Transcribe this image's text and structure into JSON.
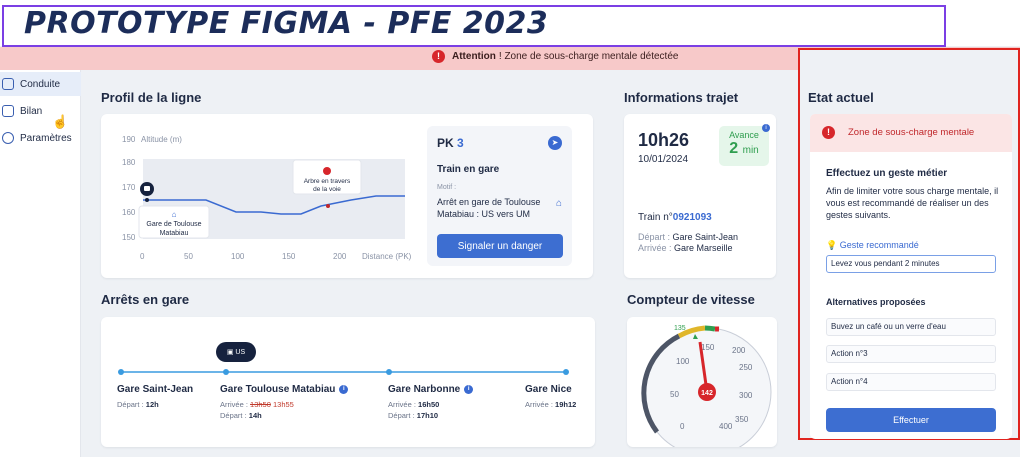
{
  "title": "PROTOTYPE FIGMA - PFE 2023",
  "alert": {
    "bold": "Attention",
    "text": "! Zone de sous-charge mentale détectée",
    "icon": "alert-icon",
    "bg": "#f7c9c9"
  },
  "sidebar": {
    "items": [
      {
        "label": "Conduite",
        "icon": "train-icon"
      },
      {
        "label": "Bilan",
        "icon": "chart-icon"
      },
      {
        "label": "Paramètres",
        "icon": "gear-icon"
      }
    ]
  },
  "profil": {
    "title": "Profil de la ligne",
    "yaxis_label": "Altitude (m)",
    "xaxis_label": "Distance (PK)",
    "y_ticks": [
      "190",
      "180",
      "170",
      "160",
      "150"
    ],
    "x_ticks": [
      "0",
      "50",
      "100",
      "150",
      "200"
    ],
    "station_label": "Gare de Toulouse Matabiau",
    "obstacle_label": "Arbre en travers de la voie",
    "pk": {
      "label": "PK",
      "value": "3"
    },
    "status": "Train en gare",
    "motif_label": "Motif :",
    "motif": "Arrêt en gare de Toulouse Matabiau : US vers UM",
    "danger_button": "Signaler un danger"
  },
  "trajet": {
    "title": "Informations trajet",
    "time": "10h26",
    "date": "10/01/2024",
    "avance_label": "Avance",
    "avance_value": "2",
    "avance_unit": "min",
    "train_label": "Train n°",
    "train_number": "0921093",
    "depart_label": "Départ :",
    "depart": "Gare Saint-Jean",
    "arrivee_label": "Arrivée :",
    "arrivee": "Gare Marseille"
  },
  "arrets": {
    "title": "Arrêts en gare",
    "train_badge": "US",
    "stops": [
      {
        "name": "Gare Saint-Jean",
        "line1_label": "Départ :",
        "line1_value": "12h"
      },
      {
        "name": "Gare Toulouse Matabiau",
        "line1_label": "Arrivée :",
        "line1_old": "13h50",
        "line1_new": "13h55",
        "line2_label": "Départ :",
        "line2_value": "14h"
      },
      {
        "name": "Gare Narbonne",
        "line1_label": "Arrivée :",
        "line1_value": "16h50",
        "line2_label": "Départ :",
        "line2_value": "17h10"
      },
      {
        "name": "Gare Nice",
        "line1_label": "Arrivée :",
        "line1_value": "19h12"
      }
    ]
  },
  "vitesse": {
    "title": "Compteur de vitesse",
    "current": "142",
    "limit": "135",
    "ticks": [
      "0",
      "50",
      "100",
      "150",
      "200",
      "250",
      "300",
      "350",
      "400"
    ]
  },
  "etat": {
    "title": "Etat actuel",
    "alert": "Zone de sous-charge mentale",
    "question": "Effectuez un geste métier",
    "paragraph": "Afin de limiter votre sous charge mentale, il vous est recommandé de réaliser un des gestes suivants.",
    "recommended_label": "Geste recommandé",
    "recommended_value": "Levez vous pendant 2 minutes",
    "alternatives_label": "Alternatives proposées",
    "alternatives": [
      "Buvez un café ou un verre d'eau",
      "Action n°3",
      "Action n°4"
    ],
    "submit": "Effectuer"
  }
}
